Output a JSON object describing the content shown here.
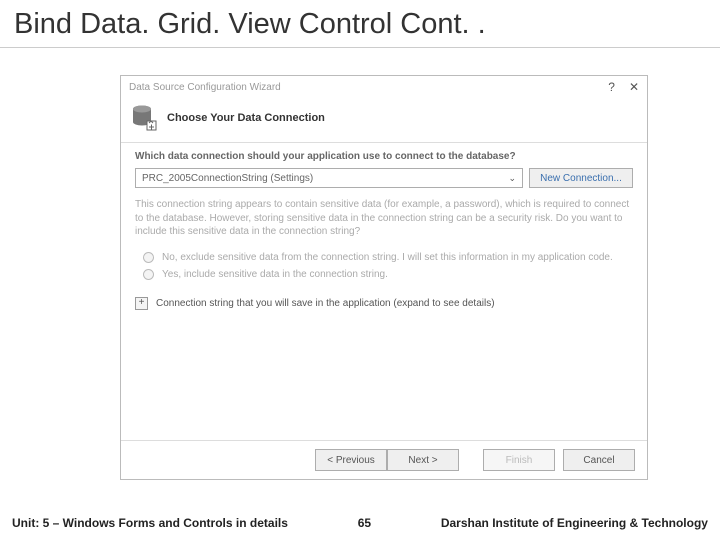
{
  "slide": {
    "title": "Bind Data. Grid. View Control Cont. ."
  },
  "wizard": {
    "window_title": "Data Source Configuration Wizard",
    "header": "Choose Your Data Connection",
    "question": "Which data connection should your application use to connect to the database?",
    "selected_connection": "PRC_2005ConnectionString (Settings)",
    "new_connection_label": "New Connection...",
    "explanation": "This connection string appears to contain sensitive data (for example, a password), which is required to connect to the database. However, storing sensitive data in the connection string can be a security risk. Do you want to include this sensitive data in the connection string?",
    "radio_no": "No, exclude sensitive data from the connection string. I will set this information in my application code.",
    "radio_yes": "Yes, include sensitive data in the connection string.",
    "expand_label": "Connection string that you will save in the application (expand to see details)",
    "buttons": {
      "previous": "< Previous",
      "next": "Next >",
      "finish": "Finish",
      "cancel": "Cancel"
    }
  },
  "footer": {
    "unit": "Unit: 5 – Windows Forms and Controls in details",
    "page": "65",
    "institute": "Darshan Institute of Engineering & Technology"
  }
}
